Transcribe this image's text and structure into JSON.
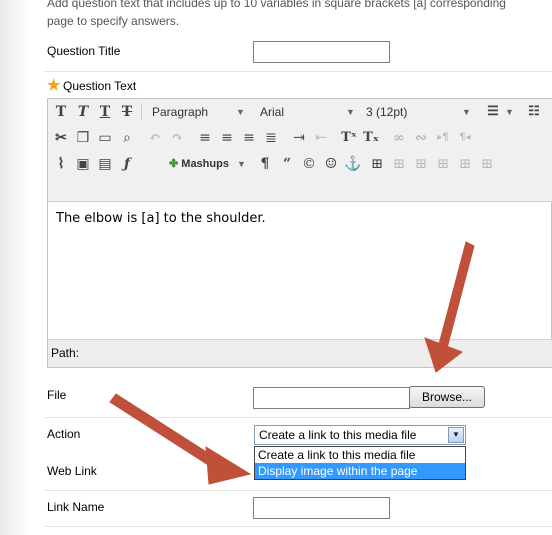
{
  "intro_text": "Add question text that includes up to 10 variables in square brackets [a] corresponding to the page to specify answers.",
  "intro_line1": "Add question text that includes up to 10 variables in square brackets [a] corresponding",
  "intro_line2": "page to specify answers.",
  "fields": {
    "question_title_label": "Question Title",
    "question_title_value": "",
    "question_text_label": "Question Text",
    "required_marker": "★",
    "file_label": "File",
    "file_value": "",
    "browse_label": "Browse...",
    "action_label": "Action",
    "action_selected": "Create a link to this media file",
    "action_options": [
      "Create a link to this media file",
      "Display image within the page"
    ],
    "web_link_label": "Web Link",
    "link_name_label": "Link Name",
    "link_name_value": ""
  },
  "editor": {
    "paragraph_select": "Paragraph",
    "font_select": "Arial",
    "size_select": "3 (12pt)",
    "mashups_label": "Mashups",
    "content_text": "The elbow is [a] to the shoulder.",
    "path_label": "Path:"
  },
  "colors": {
    "required_star": "#f4a21a",
    "arrow": "#c0503a",
    "selected_option": "#3399ff"
  }
}
